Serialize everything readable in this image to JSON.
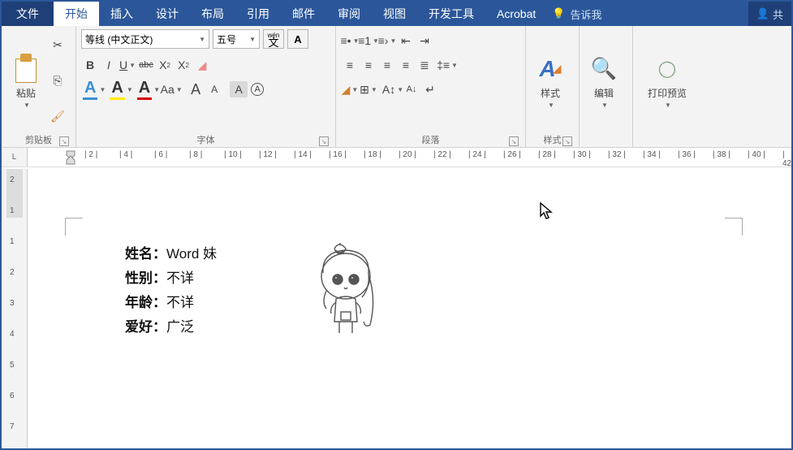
{
  "tabs": {
    "file": "文件",
    "home": "开始",
    "insert": "插入",
    "design": "设计",
    "layout": "布局",
    "references": "引用",
    "mailings": "邮件",
    "review": "审阅",
    "view": "视图",
    "developer": "开发工具",
    "acrobat": "Acrobat",
    "tellme": "告诉我",
    "share": "共"
  },
  "clipboard": {
    "paste": "粘贴",
    "group": "剪贴板"
  },
  "font": {
    "family": "等线 (中文正文)",
    "size": "五号",
    "wen": "wén",
    "group": "字体",
    "bold": "B",
    "italic": "I",
    "underline": "U",
    "strike": "abc",
    "sub": "X",
    "sup": "X",
    "bigA": "A",
    "smallA": "A",
    "Aa": "Aa",
    "highlightA": "A",
    "fontcolorA": "A",
    "pinyinA": "A",
    "circleA": "A",
    "boxA": "A",
    "clear": "A"
  },
  "paragraph": {
    "group": "段落"
  },
  "styles": {
    "label": "样式",
    "group": "样式"
  },
  "editing": {
    "label": "编辑"
  },
  "preview": {
    "label": "打印预览"
  },
  "ruler": {
    "marks": [
      "2",
      "4",
      "6",
      "8",
      "10",
      "12",
      "14",
      "16",
      "18",
      "20",
      "22",
      "24",
      "26",
      "28",
      "30",
      "32",
      "34",
      "36",
      "38",
      "40",
      "42"
    ]
  },
  "vruler": {
    "marks": [
      "2",
      "1",
      "1",
      "2",
      "3",
      "4",
      "5",
      "6",
      "7"
    ]
  },
  "document": {
    "rows": [
      {
        "label": "姓名：",
        "value": "Word 妹"
      },
      {
        "label": "性别：",
        "value": "不详"
      },
      {
        "label": "年龄：",
        "value": "不详"
      },
      {
        "label": "爱好：",
        "value": "广泛"
      }
    ]
  }
}
